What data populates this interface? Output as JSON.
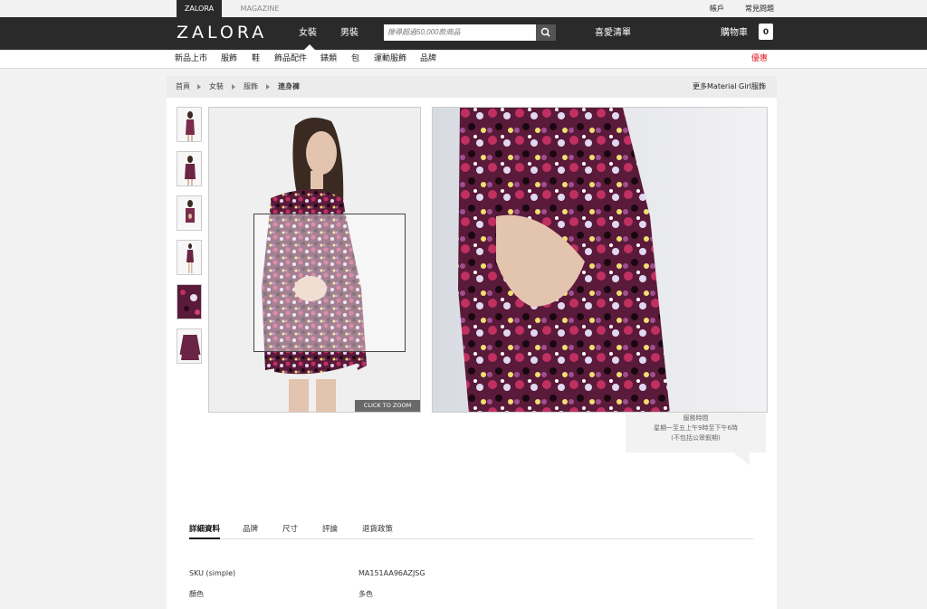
{
  "util_bar": {
    "tab_zalora": "ZALORA",
    "tab_magazine": "MAGAZINE",
    "account": "帳戶",
    "faq": "常見問題"
  },
  "header": {
    "logo": "ZALORA",
    "nav_women": "女裝",
    "nav_men": "男裝",
    "search_placeholder": "搜尋超過50,000款商品",
    "wishlist": "喜愛清單",
    "cart": "購物車",
    "cart_count": "0"
  },
  "categories": {
    "items": [
      "新品上市",
      "服飾",
      "鞋",
      "飾品配件",
      "錶類",
      "包",
      "運動服飾",
      "品牌"
    ],
    "sale": "優惠"
  },
  "breadcrumb": {
    "items": [
      "首頁",
      "女裝",
      "服飾",
      "連身褲"
    ],
    "more": "更多Material Girl服飾"
  },
  "product": {
    "zoom_label": "CLICK TO ZOOM"
  },
  "service_hours": {
    "title": "服務時間",
    "line1": "星期一至五上午9時至下午6時",
    "line2": "(不包括公眾假期)"
  },
  "tabs": [
    "詳細資料",
    "品牌",
    "尺寸",
    "評論",
    "退貨政策"
  ],
  "details": {
    "sku_label": "SKU (simple)",
    "sku_value": "MA151AA96AZJSG",
    "color_label": "顏色",
    "color_value": "多色"
  },
  "colors": {
    "header_bg": "#2a2a2a",
    "sale": "#e0202a"
  }
}
